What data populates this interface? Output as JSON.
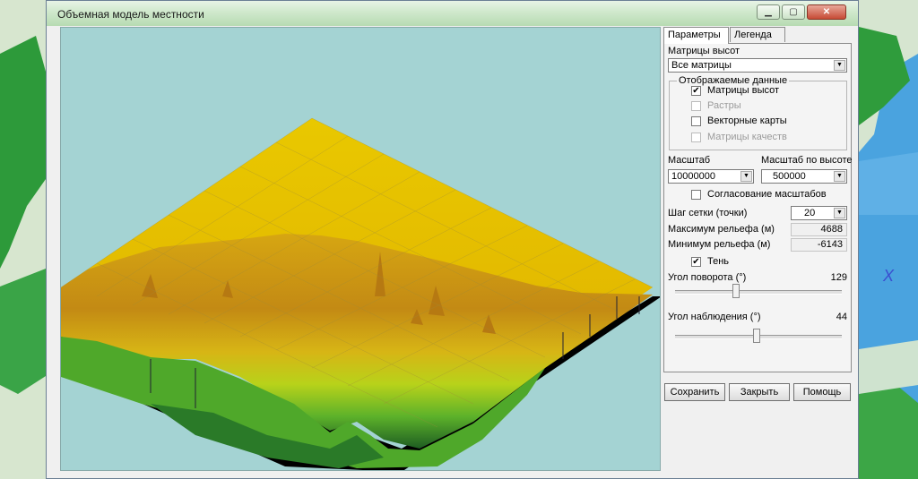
{
  "window": {
    "title": "Объемная модель местности",
    "minimize_icon": "minimize-icon",
    "maximize_icon": "maximize-icon",
    "close_icon": "close-icon"
  },
  "tabs": [
    {
      "label": "Параметры",
      "active": true
    },
    {
      "label": "Легенда",
      "active": false
    }
  ],
  "matrices": {
    "label": "Матрицы высот",
    "selected": "Все матрицы"
  },
  "display_group": {
    "title": "Отображаемые данные",
    "items": [
      {
        "label": "Матрицы высот",
        "checked": true,
        "enabled": true
      },
      {
        "label": "Растры",
        "checked": false,
        "enabled": false
      },
      {
        "label": "Векторные карты",
        "checked": false,
        "enabled": true
      },
      {
        "label": "Матрицы качеств",
        "checked": false,
        "enabled": false
      }
    ]
  },
  "scale": {
    "label": "Масштаб",
    "value": "10000000",
    "height_label": "Масштаб по высоте",
    "height_value": "500000",
    "sync_label": "Согласование масштабов",
    "sync_checked": false
  },
  "grid": {
    "step_label": "Шаг сетки (точки)",
    "step_value": "20",
    "max_label": "Максимум рельефа (м)",
    "max_value": "4688",
    "min_label": "Минимум рельефа (м)",
    "min_value": "-6143"
  },
  "shadow": {
    "label": "Тень",
    "checked": true
  },
  "rotation": {
    "label": "Угол поворота (°)",
    "value": "129",
    "position": 0.36
  },
  "observation": {
    "label": "Угол наблюдения (°)",
    "value": "44",
    "position": 0.49
  },
  "buttons": {
    "save": "Сохранить",
    "close": "Закрыть",
    "help": "Помощь"
  },
  "background_map": {
    "marker": "X"
  },
  "colors": {
    "viewport_bg": "#a4d3d3",
    "terrain_top": "#e6c400",
    "terrain_mid": "#c89a10",
    "terrain_low": "#6dbb2a",
    "terrain_deep": "#1f6b2a",
    "map_water": "#4aa3df",
    "map_land": "#cfe4c2"
  }
}
